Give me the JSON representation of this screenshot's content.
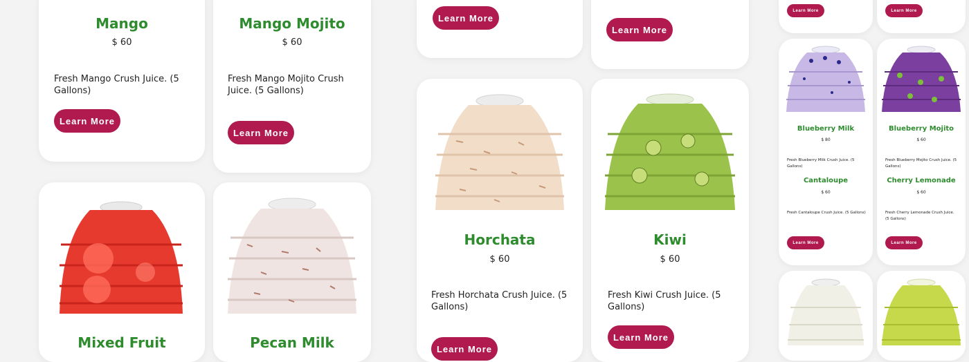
{
  "button_label": "Learn More",
  "colors": {
    "title": "#2e8b2e",
    "button": "#b01a4e",
    "background": "#f3f3f3"
  },
  "products": {
    "mango": {
      "name": "Mango",
      "price": "$ 60",
      "desc": "Fresh Mango Crush Juice. (5 Gallons)"
    },
    "mango_mojito": {
      "name": "Mango Mojito",
      "price": "$ 60",
      "desc": "Fresh Mango Mojito Crush Juice. (5 Gallons)"
    },
    "horchata": {
      "name": "Horchata",
      "price": "$ 60",
      "desc": "Fresh Horchata Crush Juice. (5 Gallons)"
    },
    "kiwi": {
      "name": "Kiwi",
      "price": "$ 60",
      "desc": "Fresh Kiwi Crush Juice. (5 Gallons)"
    },
    "mixed_fruit": {
      "name": "Mixed Fruit"
    },
    "pecan_milk": {
      "name": "Pecan Milk"
    },
    "blueberry_milk": {
      "name": "Blueberry Milk",
      "price": "$ 80",
      "desc": "Fresh Blueberry Milk Crush Juice. (5 Gallons)"
    },
    "blueberry_mojito": {
      "name": "Blueberry Mojito",
      "price": "$ 60",
      "desc": "Fresh Blueberry Mojito Crush Juice. (5 Gallons)"
    },
    "cantaloupe": {
      "name": "Cantaloupe",
      "price": "$ 60",
      "desc": "Fresh Cantaloupe Crush Juice. (5 Gallons)"
    },
    "cherry_lemonade": {
      "name": "Cherry Lemonade",
      "price": "$ 60",
      "desc": "Fresh Cherry Lemonade Crush Juice. (5 Gallons)"
    }
  }
}
